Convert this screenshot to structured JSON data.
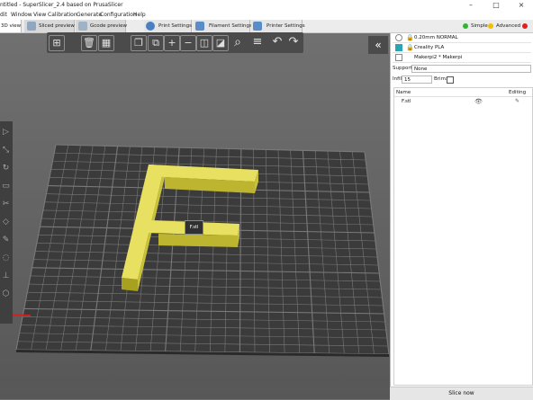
{
  "window": {
    "title": "ntitled - SuperSlicer_2.4  based on PrusaSlicer",
    "buttons": [
      "–",
      "□",
      "×"
    ]
  },
  "menu": [
    "dit",
    "Window",
    "View",
    "Calibration",
    "Generate",
    "Configuration",
    "Help"
  ],
  "tabs": [
    {
      "label": "3D view",
      "active": true
    },
    {
      "label": "Sliced preview",
      "active": false
    },
    {
      "label": "Gcode preview",
      "active": false
    },
    {
      "label": "Print Settings",
      "active": false
    },
    {
      "label": "Filament Settings",
      "active": false
    },
    {
      "label": "Printer Settings",
      "active": false
    }
  ],
  "modes": [
    {
      "label": "Simple",
      "color": "#2fb52f"
    },
    {
      "label": "Advanced",
      "color": "#f0c000"
    },
    {
      "label": "Expert",
      "color": "#e02020"
    }
  ],
  "toolbar": {
    "add_icon": "add-cube-icon",
    "delete_icon": "trash-icon",
    "arrange_icon": "arrange-icon",
    "copy_icon": "copy-icon",
    "paste_icon": "paste-icon",
    "search_icon": "search-icon",
    "layers_icon": "layers-icon",
    "undo_icon": "undo-icon",
    "redo_icon": "redo-icon",
    "collapse_label": "«"
  },
  "viewport": {
    "object_tooltip": "F.stl",
    "bed_color": "#3d3d3d",
    "grid_color": "#7a7a7a",
    "object_color": "#d4cc3a"
  },
  "sidebar": {
    "print_preset": "0.20mm NORMAL",
    "filament_preset": "Creality PLA",
    "filament_color": "#2aa5b5",
    "printer_preset": "Makerpi2 * Makerpi",
    "supports_label": "Supports:",
    "supports_value": "None",
    "infill_label": "Infill:",
    "infill_value": "15",
    "brim_label": "Brim:",
    "columns": {
      "name": "Name",
      "editing": "Editing"
    },
    "objects": [
      {
        "name": "F.stl"
      }
    ],
    "slice_button": "Slice now"
  }
}
